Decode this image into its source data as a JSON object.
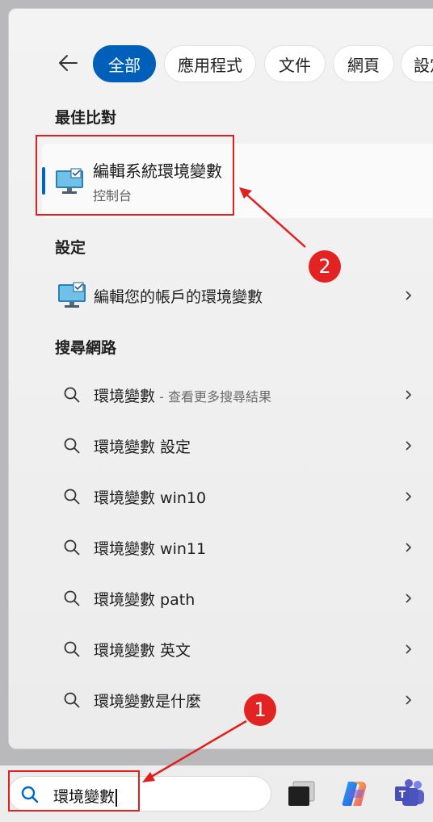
{
  "filters": {
    "back_label": "",
    "chips": [
      {
        "label": "全部",
        "active": true
      },
      {
        "label": "應用程式",
        "active": false
      },
      {
        "label": "文件",
        "active": false
      },
      {
        "label": "網頁",
        "active": false
      },
      {
        "label": "設定",
        "active": false
      }
    ]
  },
  "sections": {
    "best_match_title": "最佳比對",
    "settings_title": "設定",
    "web_title": "搜尋網路"
  },
  "best_match": {
    "title": "編輯系統環境變數",
    "subtitle": "控制台"
  },
  "settings_result": {
    "label": "編輯您的帳戶的環境變數"
  },
  "web_results": [
    {
      "label": "環境變數",
      "suffix": " - 查看更多搜尋結果"
    },
    {
      "label": "環境變數 設定",
      "suffix": ""
    },
    {
      "label": "環境變數 win10",
      "suffix": ""
    },
    {
      "label": "環境變數 win11",
      "suffix": ""
    },
    {
      "label": "環境變數 path",
      "suffix": ""
    },
    {
      "label": "環境變數 英文",
      "suffix": ""
    },
    {
      "label": "環境變數是什麼",
      "suffix": ""
    }
  ],
  "taskbar": {
    "search_query": "環境變數"
  },
  "annotations": {
    "badge_1": "1",
    "badge_2": "2"
  },
  "colors": {
    "accent": "#005fb8",
    "annotation_red": "#e01f1f"
  },
  "icons": {
    "back": "arrow-left-icon",
    "app": "monitor-settings-icon",
    "search": "search-icon",
    "chevron": "chevron-right-icon"
  }
}
